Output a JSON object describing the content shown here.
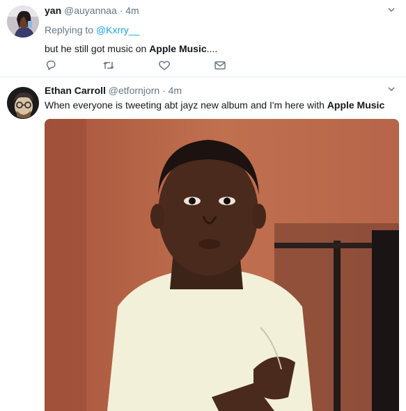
{
  "tweets": [
    {
      "name": "yan",
      "handle": "@auyannaa",
      "time": "4m",
      "replying_to_label": "Replying to",
      "replying_to_handle": "@Kxrry__",
      "text_before": "but he still got music on ",
      "text_bold": "Apple Music",
      "text_after": "....",
      "actions": [
        "reply-icon",
        "retweet-icon",
        "like-icon",
        "direct-message-icon"
      ]
    },
    {
      "name": "Ethan Carroll",
      "handle": "@etfornjorn",
      "time": "4m",
      "text_before": "When everyone is tweeting abt jayz new album and I'm here with ",
      "text_bold": "Apple Music",
      "text_after": ""
    }
  ],
  "separator": "·",
  "colors": {
    "link": "#1da1f2",
    "muted": "#657786",
    "text": "#14171a",
    "border": "#e6ecf0"
  }
}
